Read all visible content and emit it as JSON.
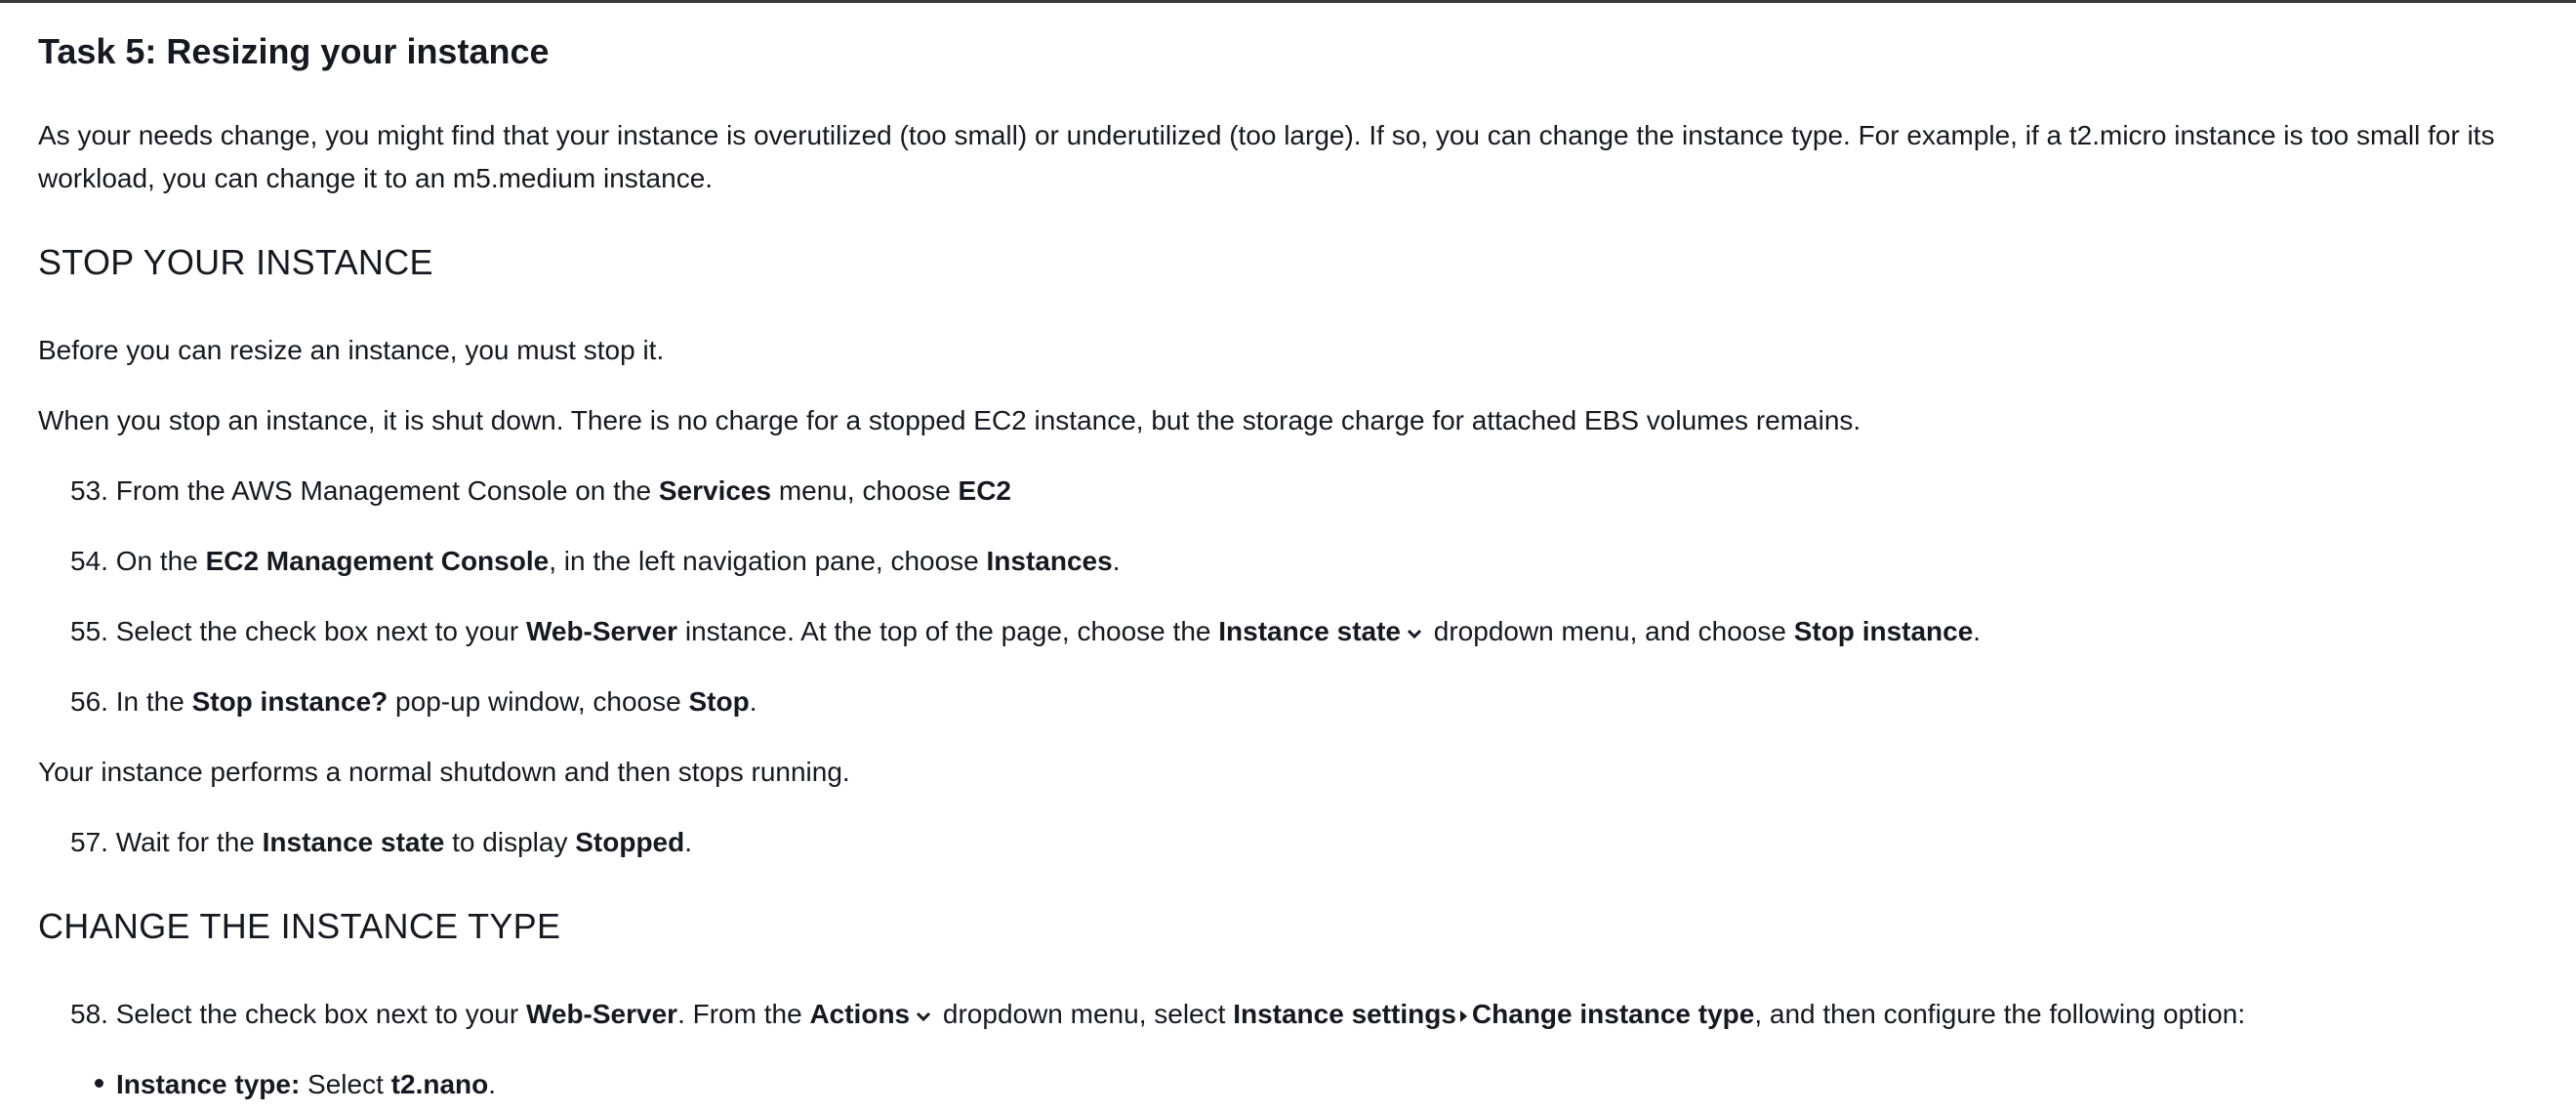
{
  "task_title": "Task 5: Resizing your instance",
  "intro": "As your needs change, you might find that your instance is overutilized (too small) or underutilized (too large). If so, you can change the instance type. For example, if a t2.micro instance is too small for its workload, you can change it to an m5.medium instance.",
  "section_stop": {
    "heading": "STOP YOUR INSTANCE",
    "para1": "Before you can resize an instance, you must stop it.",
    "para2": "When you stop an instance, it is shut down. There is no charge for a stopped EC2 instance, but the storage charge for attached EBS volumes remains."
  },
  "step53": {
    "num": "53.",
    "t1": "From the AWS Management Console on the ",
    "b1": "Services",
    "t2": " menu, choose ",
    "b2": "EC2"
  },
  "step54": {
    "num": "54.",
    "t1": "On the ",
    "b1": "EC2 Management Console",
    "t2": ", in the left navigation pane, choose ",
    "b2": "Instances",
    "t3": "."
  },
  "step55": {
    "num": "55.",
    "t1": "Select the check box next to your ",
    "b1": "Web-Server",
    "t2": " instance. At the top of the page, choose the ",
    "b2": "Instance state",
    "t3": " dropdown menu, and choose ",
    "b3": "Stop instance",
    "t4": "."
  },
  "step56": {
    "num": "56.",
    "t1": "In the ",
    "b1": "Stop instance?",
    "t2": " pop-up window, choose ",
    "b2": "Stop",
    "t3": "."
  },
  "after56": "Your instance performs a normal shutdown and then stops running.",
  "step57": {
    "num": "57.",
    "t1": "Wait for the ",
    "b1": "Instance state",
    "t2": " to display ",
    "b2": "Stopped",
    "t3": "."
  },
  "section_change": {
    "heading": "CHANGE THE INSTANCE TYPE"
  },
  "step58": {
    "num": "58.",
    "t1": "Select the check box next to your ",
    "b1": "Web-Server",
    "t2": ". From the ",
    "b2": "Actions",
    "t3": " dropdown menu, select ",
    "b3": "Instance settings",
    "b4": "Change instance type",
    "t4": ", and then configure the following option:"
  },
  "bullet1": {
    "b1": "Instance type:",
    "t1": " Select ",
    "b2": "t2.nano",
    "t2": "."
  },
  "icons": {
    "dropdown": "chevron-down-icon",
    "submenu": "caret-right-icon"
  }
}
